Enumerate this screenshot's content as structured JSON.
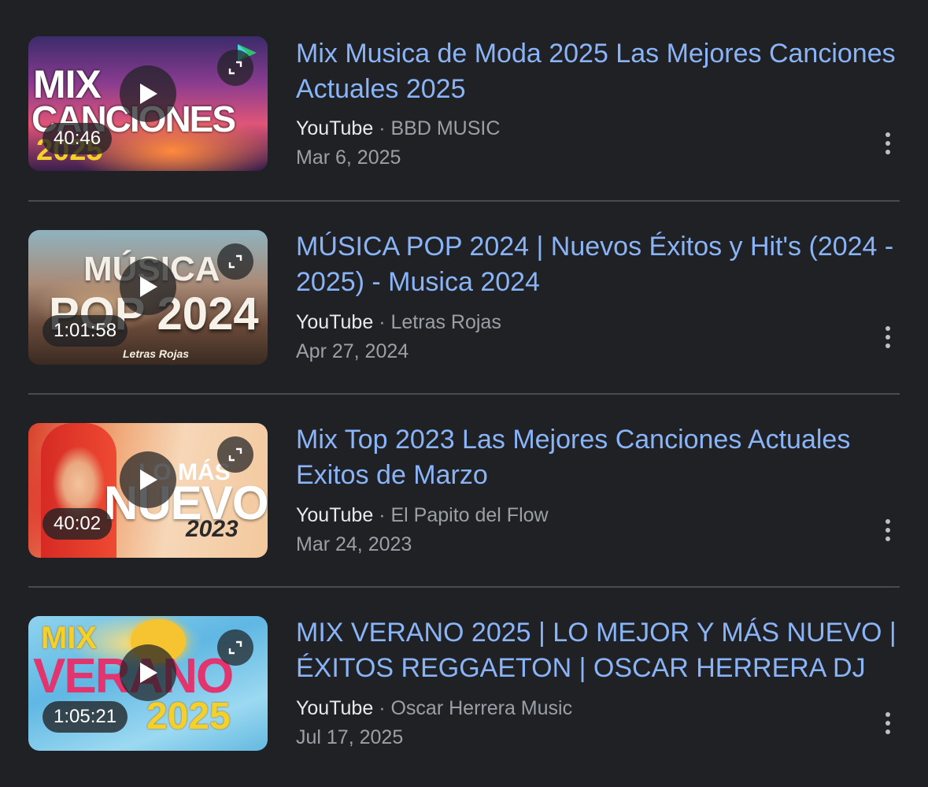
{
  "results": [
    {
      "title": "Mix Musica de Moda 2025 Las Mejores Canciones Actuales 2025",
      "site": "YouTube",
      "separator": "·",
      "channel": "BBD MUSIC",
      "date": "Mar 6, 2025",
      "duration": "40:46",
      "thumb_text": [
        "MIX",
        "CANCIONES",
        "2025"
      ]
    },
    {
      "title": "MÚSICA POP 2024 | Nuevos Éxitos y Hit's (2024 - 2025) - Musica 2024",
      "site": "YouTube",
      "separator": "·",
      "channel": "Letras Rojas",
      "date": "Apr 27, 2024",
      "duration": "1:01:58",
      "thumb_text": [
        "MÚSICA",
        "POP 2024",
        "Letras Rojas"
      ]
    },
    {
      "title": "Mix Top 2023 Las Mejores Canciones Actuales Exitos de Marzo",
      "site": "YouTube",
      "separator": "·",
      "channel": "El Papito del Flow",
      "date": "Mar 24, 2023",
      "duration": "40:02",
      "thumb_text": [
        "LO MÁS",
        "NUEVO",
        "2023"
      ]
    },
    {
      "title": "MIX VERANO 2025 | LO MEJOR Y MÁS NUEVO | ÉXITOS REGGAETON | OSCAR HERRERA DJ",
      "site": "YouTube",
      "separator": "·",
      "channel": "Oscar Herrera Music",
      "date": "Jul 17, 2025",
      "duration": "1:05:21",
      "thumb_text": [
        "MIX",
        "VERANO",
        "2025"
      ]
    }
  ],
  "colors": {
    "background": "#202124",
    "title_link": "#8ab4f8",
    "site_text": "#e8eaed",
    "meta_text": "#9aa0a6",
    "divider": "#4a4b4e"
  },
  "icons": {
    "play": "play-icon",
    "expand": "expand-icon",
    "more": "more-vert-icon",
    "badge": "google-play-badge-icon"
  }
}
